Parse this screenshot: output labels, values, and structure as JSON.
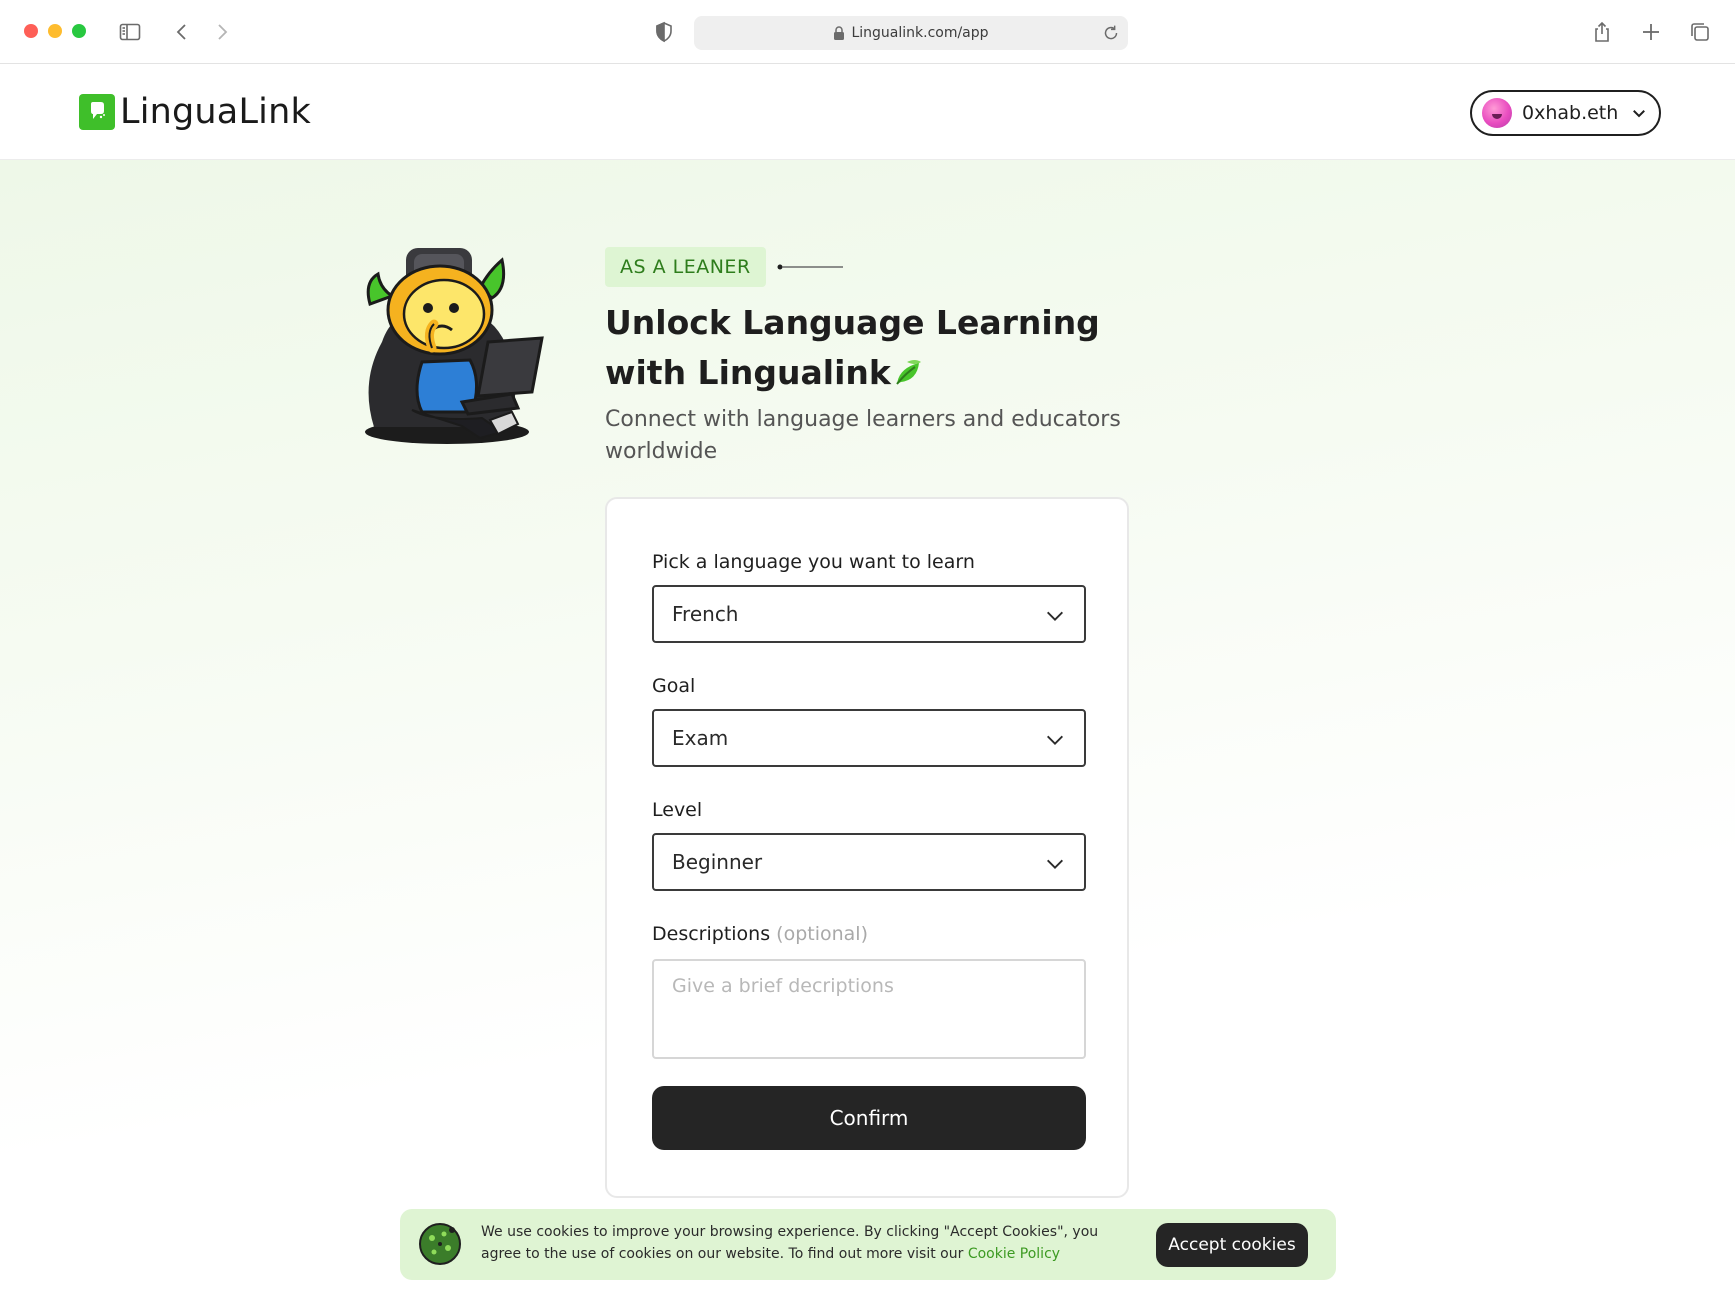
{
  "browser": {
    "url": "Lingualink.com/app"
  },
  "header": {
    "brand": "LinguaLink",
    "user": "0xhab.eth"
  },
  "hero": {
    "tag": "AS A LEANER",
    "headline_line1": "Unlock Language Learning",
    "headline_line2": "with Lingualink",
    "subheadline": "Connect with language learners and educators worldwide"
  },
  "form": {
    "language_label": "Pick a language you want to learn",
    "language_value": "French",
    "goal_label": "Goal",
    "goal_value": "Exam",
    "level_label": "Level",
    "level_value": "Beginner",
    "descriptions_label": "Descriptions",
    "descriptions_optional": "(optional)",
    "descriptions_placeholder": "Give a brief decriptions",
    "confirm_label": "Confirm"
  },
  "cookie": {
    "text": "We use cookies to improve your browsing experience. By clicking \"Accept Cookies\", you agree to the use of cookies on our website. To find out more visit our",
    "link": "Cookie Policy",
    "accept_label": "Accept cookies"
  },
  "colors": {
    "brand_green": "#3fbf2a",
    "tag_bg": "#def5d3",
    "tag_text": "#2e7d1c",
    "button_dark": "#252525",
    "cookie_bg": "#dff4d3"
  },
  "icons": [
    "sidebar-icon",
    "back-icon",
    "forward-icon",
    "shield-icon",
    "lock-icon",
    "reload-icon",
    "share-icon",
    "new-tab-icon",
    "tabs-icon",
    "chevron-down-icon",
    "leaf-icon",
    "cookie-icon"
  ]
}
